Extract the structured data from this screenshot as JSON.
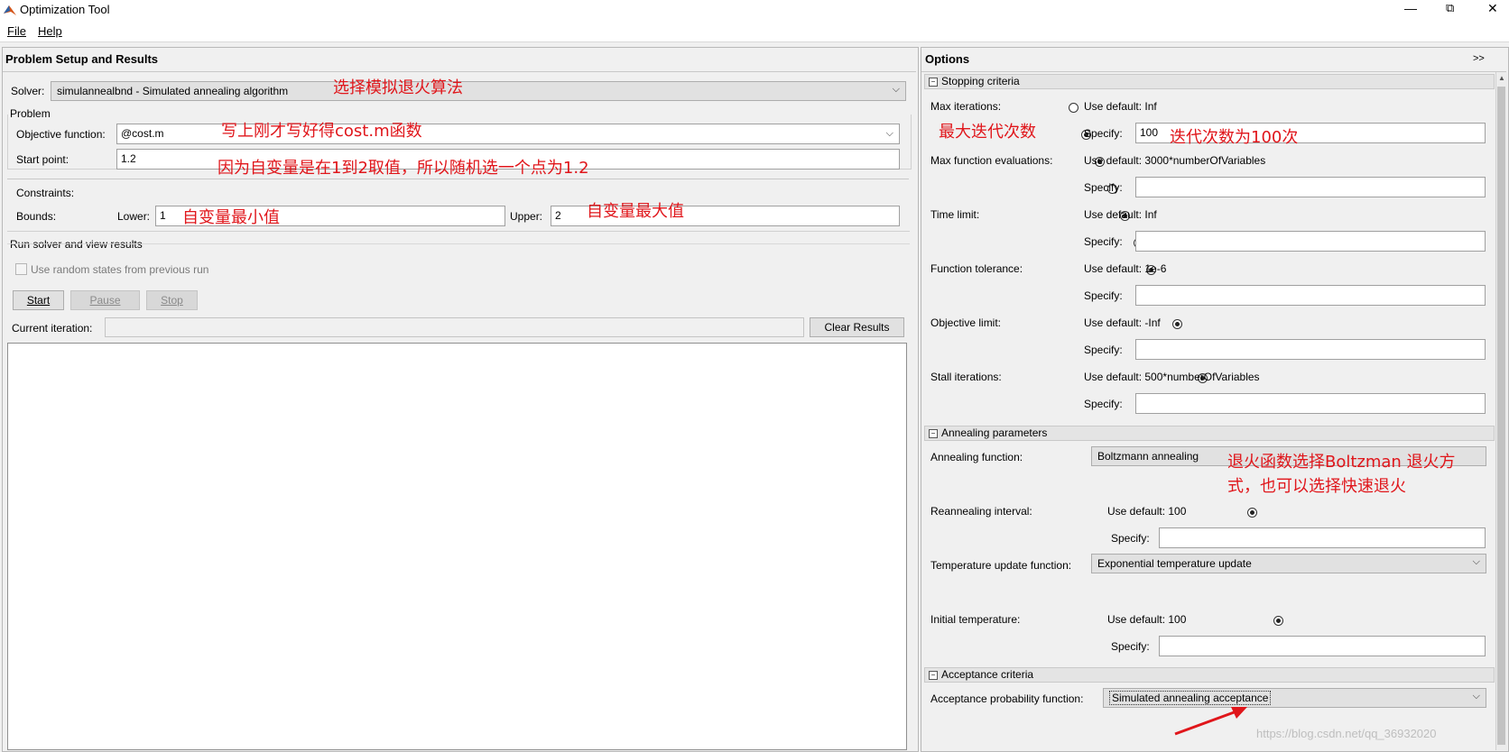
{
  "window": {
    "title": "Optimization Tool",
    "minimize": "—",
    "restore": "⧉",
    "close": "✕"
  },
  "menu": {
    "file": "File",
    "help": "Help"
  },
  "left": {
    "header": "Problem Setup and Results",
    "solver_label": "Solver:",
    "solver_value": "simulannealbnd - Simulated annealing algorithm",
    "problem_label": "Problem",
    "objective_label": "Objective function:",
    "objective_value": "@cost.m",
    "start_label": "Start point:",
    "start_value": "1.2",
    "constraints_label": "Constraints:",
    "bounds_label": "Bounds:",
    "lower_label": "Lower:",
    "lower_value": "1",
    "upper_label": "Upper:",
    "upper_value": "2",
    "run_label": "Run solver and view results",
    "random_states_label": "Use random states from previous run",
    "start_button": "Start",
    "pause_button": "Pause",
    "stop_button": "Stop",
    "current_iteration_label": "Current iteration:",
    "current_iteration_value": "",
    "clear_button": "Clear Results"
  },
  "right": {
    "header": "Options",
    "expand": ">>",
    "stopping": {
      "title": "Stopping criteria",
      "max_iter_label": "Max iterations:",
      "max_iter_default": "Use default: Inf",
      "specify": "Specify:",
      "max_iter_value": "100",
      "max_fev_label": "Max function evaluations:",
      "max_fev_default": "Use default: 3000*numberOfVariables",
      "time_label": "Time limit:",
      "time_default": "Use default: Inf",
      "ftol_label": "Function tolerance:",
      "ftol_default": "Use default: 1e-6",
      "objlim_label": "Objective limit:",
      "objlim_default": "Use default: -Inf",
      "stall_label": "Stall iterations:",
      "stall_default": "Use default: 500*numberOfVariables"
    },
    "annealing": {
      "title": "Annealing parameters",
      "func_label": "Annealing function:",
      "func_value": "Boltzmann annealing",
      "reanneal_label": "Reannealing interval:",
      "reanneal_default": "Use default: 100",
      "temp_update_label": "Temperature update function:",
      "temp_update_value": "Exponential temperature update",
      "init_temp_label": "Initial temperature:",
      "init_temp_default": "Use default: 100"
    },
    "acceptance": {
      "title": "Acceptance criteria",
      "prob_label": "Acceptance probability function:",
      "prob_value": "Simulated annealing acceptance"
    }
  },
  "annotations": {
    "solver": "选择模拟退火算法",
    "objective": "写上刚才写好得cost.m函数",
    "start": "因为自变量是在1到2取值，所以随机选一个点为1.2",
    "lower": "自变量最小值",
    "upper": "自变量最大值",
    "max_iter": "最大迭代次数",
    "iter_count": "迭代次数为100次",
    "anneal1": "退火函数选择Boltzman 退火方",
    "anneal2": "式，也可以选择快速退火"
  },
  "watermark": "https://blog.csdn.net/qq_36932020",
  "colors": {
    "annotation": "#e0161b",
    "matlab_logo": "#d4561c"
  }
}
